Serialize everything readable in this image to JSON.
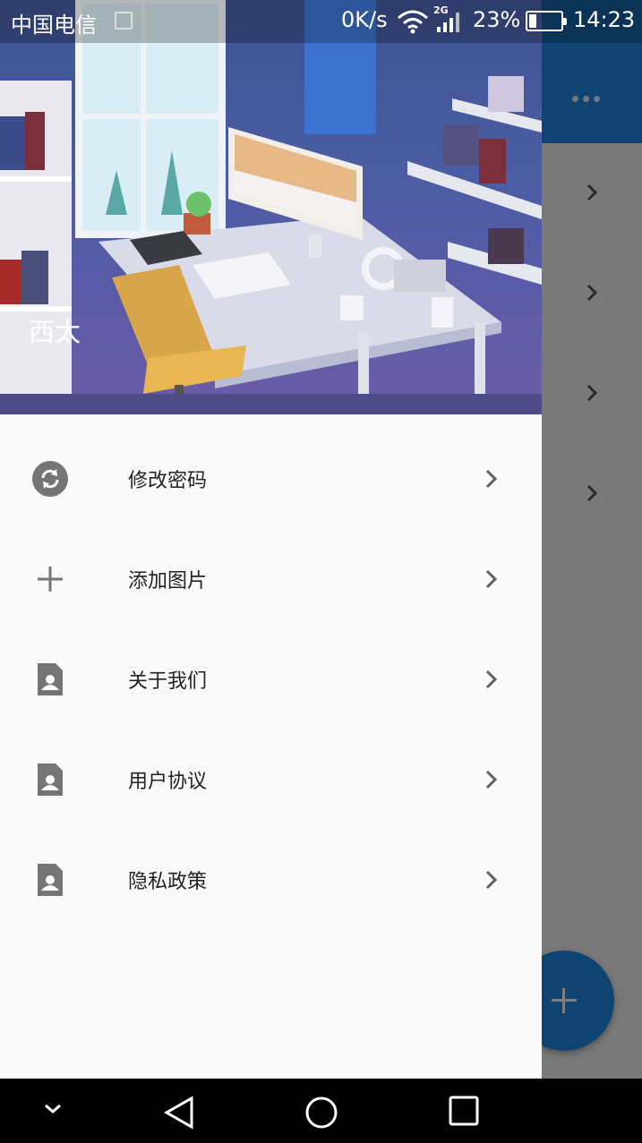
{
  "status_bar": {
    "carrier": "中国电信",
    "net_speed": "0K/s",
    "network_type": "2G",
    "battery_percent": "23%",
    "battery_level": 0.23,
    "time": "14:23"
  },
  "drawer": {
    "username": "西太",
    "items": [
      {
        "label": "修改密码",
        "icon": "sync-icon"
      },
      {
        "label": "添加图片",
        "icon": "plus-icon"
      },
      {
        "label": "关于我们",
        "icon": "contact-document-icon"
      },
      {
        "label": "用户协议",
        "icon": "contact-document-icon"
      },
      {
        "label": "隐私政策",
        "icon": "contact-document-icon"
      }
    ]
  },
  "colors": {
    "accent": "#1e88e5",
    "drawer_bg": "#fafafa",
    "icon_gray": "#757575"
  }
}
